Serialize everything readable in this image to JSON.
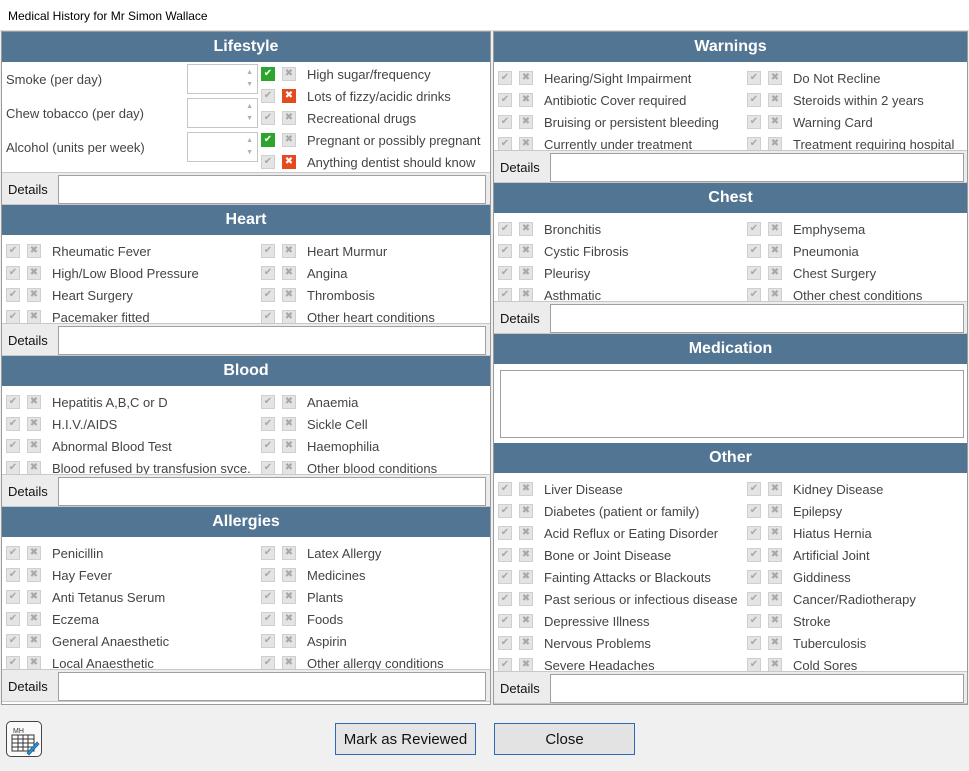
{
  "window": {
    "title": "Medical History for Mr Simon Wallace"
  },
  "details_label": "Details",
  "lifestyle": {
    "header": "Lifestyle",
    "fields": [
      "Smoke (per day)",
      "Chew tobacco (per day)",
      "Alcohol (units per week)"
    ],
    "items": [
      {
        "label": "High sugar/frequency",
        "state": "yes"
      },
      {
        "label": "Lots of fizzy/acidic drinks",
        "state": "no"
      },
      {
        "label": "Recreational drugs",
        "state": "none"
      },
      {
        "label": "Pregnant or possibly pregnant",
        "state": "yes"
      },
      {
        "label": "Anything dentist should know",
        "state": "no"
      }
    ]
  },
  "heart": {
    "header": "Heart",
    "left": [
      "Rheumatic Fever",
      "High/Low Blood Pressure",
      "Heart Surgery",
      "Pacemaker fitted"
    ],
    "right": [
      "Heart Murmur",
      "Angina",
      "Thrombosis",
      "Other heart conditions"
    ]
  },
  "blood": {
    "header": "Blood",
    "left": [
      "Hepatitis A,B,C or D",
      "H.I.V./AIDS",
      "Abnormal Blood Test",
      "Blood refused by transfusion svce."
    ],
    "right": [
      "Anaemia",
      "Sickle Cell",
      "Haemophilia",
      "Other blood conditions"
    ]
  },
  "allergies": {
    "header": "Allergies",
    "left": [
      "Penicillin",
      "Hay Fever",
      "Anti Tetanus Serum",
      "Eczema",
      "General Anaesthetic",
      "Local Anaesthetic"
    ],
    "right": [
      "Latex Allergy",
      "Medicines",
      "Plants",
      "Foods",
      "Aspirin",
      "Other allergy conditions"
    ]
  },
  "warnings": {
    "header": "Warnings",
    "left": [
      "Hearing/Sight Impairment",
      "Antibiotic Cover required",
      "Bruising or persistent bleeding",
      "Currently under treatment"
    ],
    "right": [
      "Do Not Recline",
      "Steroids within 2 years",
      "Warning Card",
      "Treatment requiring hospital"
    ]
  },
  "chest": {
    "header": "Chest",
    "left": [
      "Bronchitis",
      "Cystic Fibrosis",
      "Pleurisy",
      "Asthmatic"
    ],
    "right": [
      "Emphysema",
      "Pneumonia",
      "Chest Surgery",
      "Other chest conditions"
    ]
  },
  "medication": {
    "header": "Medication",
    "value": ""
  },
  "other": {
    "header": "Other",
    "left": [
      "Liver Disease",
      "Diabetes (patient or family)",
      "Acid Reflux or Eating Disorder",
      "Bone or Joint Disease",
      "Fainting Attacks or Blackouts",
      "Past serious or infectious disease",
      "Depressive Illness",
      "Nervous Problems",
      "Severe Headaches"
    ],
    "right": [
      "Kidney Disease",
      "Epilepsy",
      "Hiatus Hernia",
      "Artificial Joint",
      "Giddiness",
      "Cancer/Radiotherapy",
      "Stroke",
      "Tuberculosis",
      "Cold Sores"
    ]
  },
  "buttons": {
    "review": "Mark as Reviewed",
    "close": "Close",
    "icon_text": "MH"
  }
}
